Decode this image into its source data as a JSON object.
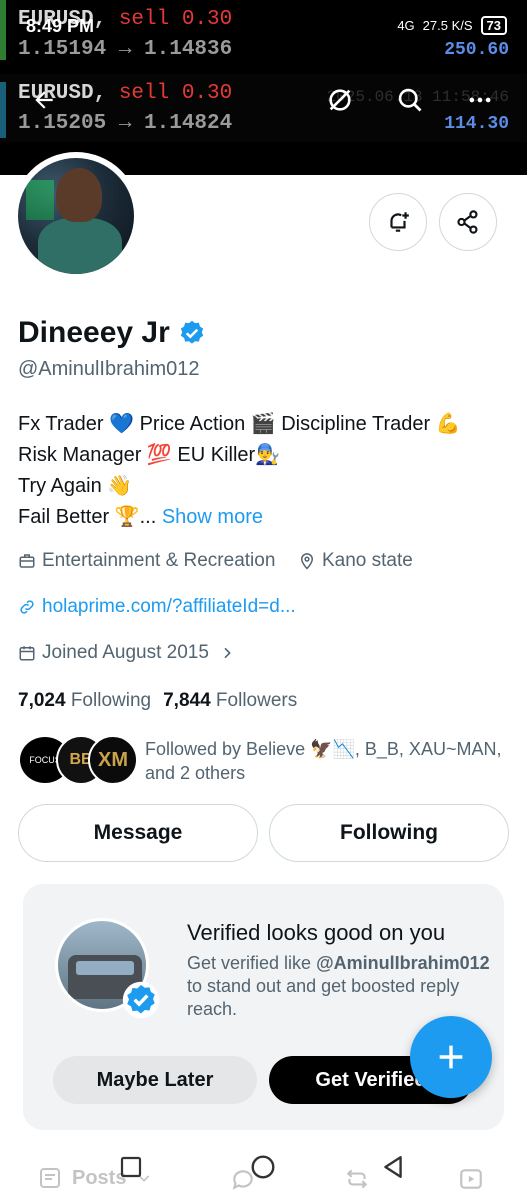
{
  "status_bar": {
    "time": "8:49 PM",
    "network": "4G",
    "speed": "27.5 K/S",
    "battery": "73"
  },
  "header_banner": {
    "ticker1": {
      "pair": "EURUSD,",
      "action": "sell 0.30",
      "price": "1.15194 → 1.14836",
      "profit": "250.60"
    },
    "ticker2": {
      "pair": "EURUSD,",
      "action": "sell 0.30",
      "price": "1.15205 → 1.14824",
      "profit": "114.30",
      "time": "2025.06.18 11:58:46"
    }
  },
  "profile": {
    "name": "Dineeey Jr",
    "handle": "@AminulIbrahim012",
    "bio_lines": [
      "Fx Trader 💙 Price Action 🎬  Discipline Trader 💪",
      "Risk Manager 💯  EU Killer👨‍🔧",
      "Try Again 👋",
      "Fail Better 🏆..."
    ],
    "show_more": "Show more",
    "category": "Entertainment & Recreation",
    "location": "Kano state",
    "link": "holaprime.com/?affiliateId=d...",
    "joined": "Joined August 2015",
    "following_count": "7,024",
    "following_label": "Following",
    "followers_count": "7,844",
    "followers_label": "Followers",
    "followed_by": "Followed by Believe 🦅📉, B_B, XAU~MAN, and 2 others",
    "follower_avatars": [
      "FOCUS",
      "BB",
      "XM"
    ]
  },
  "actions": {
    "message": "Message",
    "following": "Following"
  },
  "verified_card": {
    "title": "Verified looks good on you",
    "desc_pre": "Get verified like ",
    "desc_handle": "@AminulIbrahim012",
    "desc_post": " to stand out and get boosted reply reach.",
    "maybe_later": "Maybe Later",
    "get_verified": "Get Verified"
  },
  "tabs": {
    "posts": "Posts"
  },
  "colors": {
    "accent": "#1d9bf0",
    "text_primary": "#0f1419",
    "text_secondary": "#536471"
  }
}
